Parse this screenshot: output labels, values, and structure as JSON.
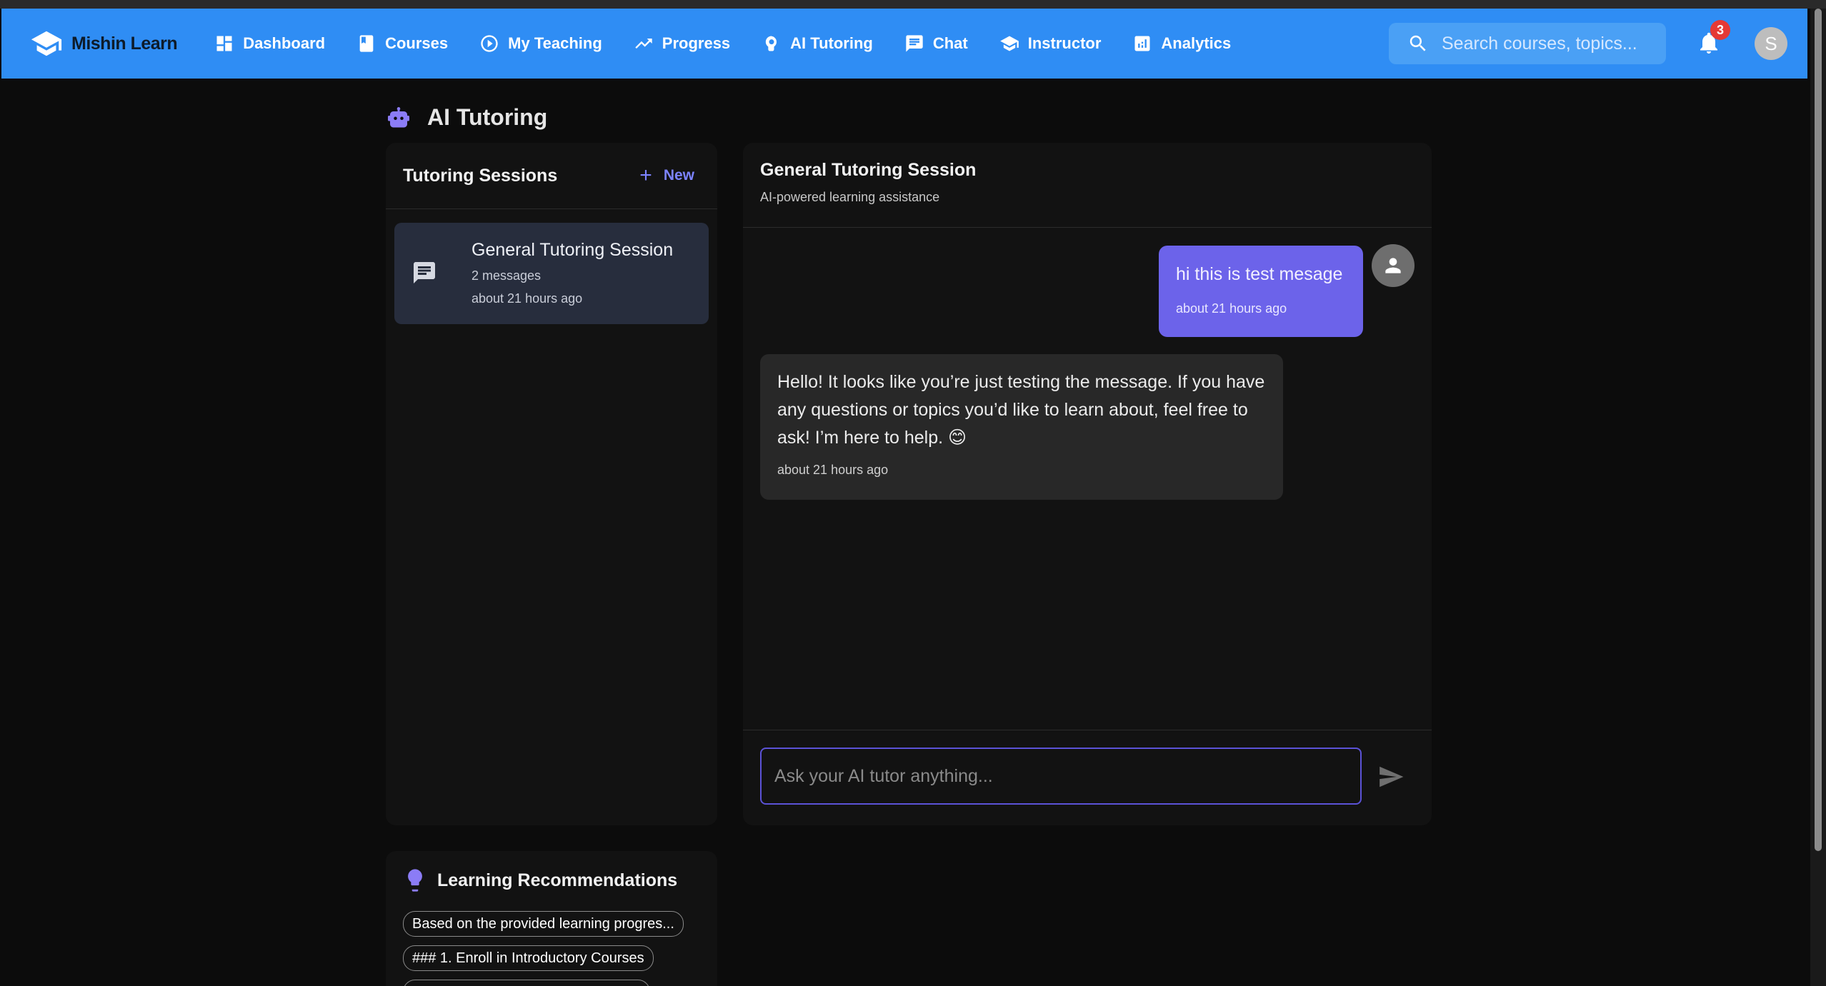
{
  "brand": {
    "name": "Mishin Learn",
    "logo_icon": "graduation-cap-icon"
  },
  "nav": {
    "items": [
      {
        "label": "Dashboard",
        "icon": "dashboard-icon"
      },
      {
        "label": "Courses",
        "icon": "book-icon"
      },
      {
        "label": "My Teaching",
        "icon": "play-circle-icon"
      },
      {
        "label": "Progress",
        "icon": "trending-up-icon"
      },
      {
        "label": "AI Tutoring",
        "icon": "psychology-icon"
      },
      {
        "label": "Chat",
        "icon": "chat-icon"
      },
      {
        "label": "Instructor",
        "icon": "school-icon"
      },
      {
        "label": "Analytics",
        "icon": "analytics-icon"
      }
    ],
    "search_placeholder": "Search courses, topics...",
    "notification_count": "3",
    "avatar_initial": "S"
  },
  "page": {
    "title": "AI Tutoring",
    "title_icon": "robot-icon"
  },
  "sessions": {
    "title": "Tutoring Sessions",
    "new_label": "New",
    "items": [
      {
        "title": "General Tutoring Session",
        "count": "2 messages",
        "time": "about 21 hours ago"
      }
    ]
  },
  "chat": {
    "title": "General Tutoring Session",
    "subtitle": "AI-powered learning assistance",
    "messages": [
      {
        "role": "user",
        "text": "hi this is test mesage",
        "time": "about 21 hours ago"
      },
      {
        "role": "assistant",
        "text": "Hello! It looks like you’re just testing the message. If you have any questions or topics you’d like to learn about, feel free to ask! I’m here to help. 😊",
        "time": "about 21 hours ago"
      }
    ],
    "input_placeholder": "Ask your AI tutor anything..."
  },
  "recommendations": {
    "title": "Learning Recommendations",
    "chips": [
      "Based on the provided learning progres...",
      "### 1. Enroll in Introductory Courses"
    ]
  },
  "colors": {
    "nav_bg": "#2f8df4",
    "accent": "#6c63ea",
    "page_bg": "#0c0c0c",
    "panel_bg": "#121212"
  }
}
